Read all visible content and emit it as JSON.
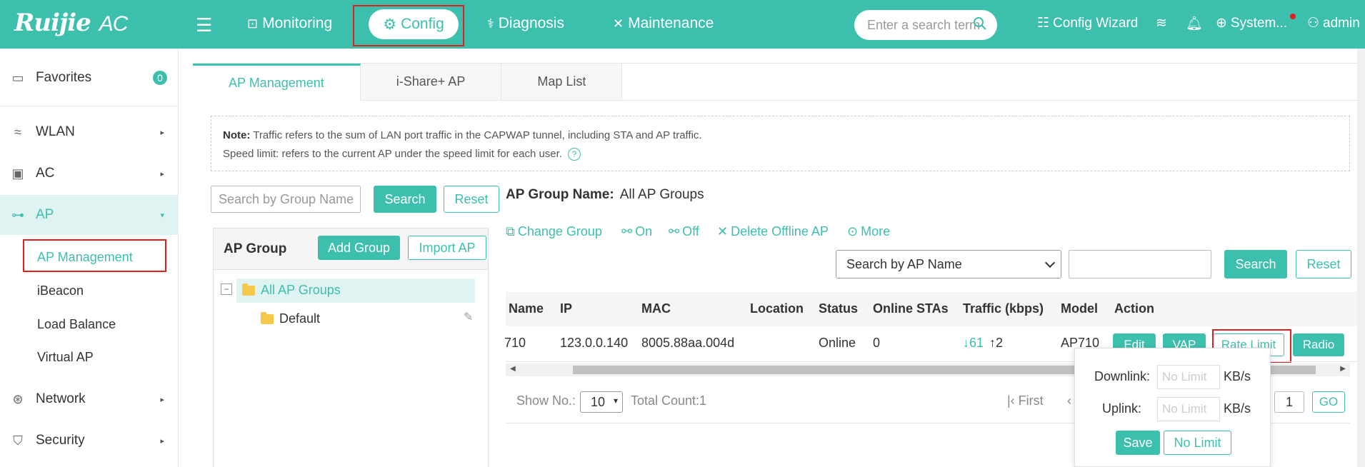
{
  "header": {
    "logo": "Ruijie",
    "logo_suffix": "AC",
    "nav": {
      "monitoring": "Monitoring",
      "config": "Config",
      "diagnosis": "Diagnosis",
      "maintenance": "Maintenance"
    },
    "search_placeholder": "Enter a search term",
    "config_wizard": "Config Wizard",
    "system": "System...",
    "user": "admin"
  },
  "sidebar": {
    "favorites": "Favorites",
    "favorites_count": "0",
    "wlan": "WLAN",
    "ac": "AC",
    "ap": "AP",
    "ap_sub": {
      "management": "AP Management",
      "ibeacon": "iBeacon",
      "load_balance": "Load Balance",
      "virtual_ap": "Virtual AP"
    },
    "network": "Network",
    "security": "Security"
  },
  "tabs": {
    "ap_management": "AP Management",
    "ishare": "i-Share+ AP",
    "map_list": "Map List"
  },
  "note": {
    "label": "Note:",
    "line1": "Traffic refers to the sum of LAN port traffic in the CAPWAP tunnel, including STA and AP traffic.",
    "line2": "Speed limit: refers to the current AP under the speed limit for each user."
  },
  "group_search": {
    "placeholder": "Search by Group Name",
    "search": "Search",
    "reset": "Reset"
  },
  "group_panel": {
    "title": "AP Group",
    "add_group": "Add Group",
    "import_ap": "Import AP",
    "tree": {
      "all": "All AP Groups",
      "default": "Default"
    }
  },
  "ap_group_name": {
    "label": "AP Group Name:",
    "value": "All AP Groups"
  },
  "toolbar": {
    "change_group": "Change Group",
    "on": "On",
    "off": "Off",
    "delete_offline": "Delete Offline AP",
    "more": "More"
  },
  "ap_search": {
    "select": "Search by AP Name",
    "search": "Search",
    "reset": "Reset"
  },
  "table": {
    "headers": {
      "name": "Name",
      "ip": "IP",
      "mac": "MAC",
      "location": "Location",
      "status": "Status",
      "online_stas": "Online STAs",
      "traffic": "Traffic (kbps)",
      "model": "Model",
      "action": "Action"
    },
    "row": {
      "name": "710",
      "ip": "123.0.0.140",
      "mac": "8005.88aa.004d",
      "location": "",
      "status": "Online",
      "online_stas": "0",
      "traffic_down": "61",
      "traffic_up": "2",
      "model": "AP710"
    },
    "actions": {
      "edit": "Edit",
      "vap": "VAP",
      "rate_limit": "Rate Limit",
      "radio": "Radio"
    }
  },
  "pager": {
    "show_no": "Show No.:",
    "page_size": "10",
    "total": "Total Count:1",
    "first": "First",
    "page": "1",
    "go": "GO"
  },
  "rate_popover": {
    "downlink": "Downlink:",
    "uplink": "Uplink:",
    "placeholder": "No Limit",
    "unit": "KB/s",
    "save": "Save",
    "no_limit": "No Limit"
  }
}
